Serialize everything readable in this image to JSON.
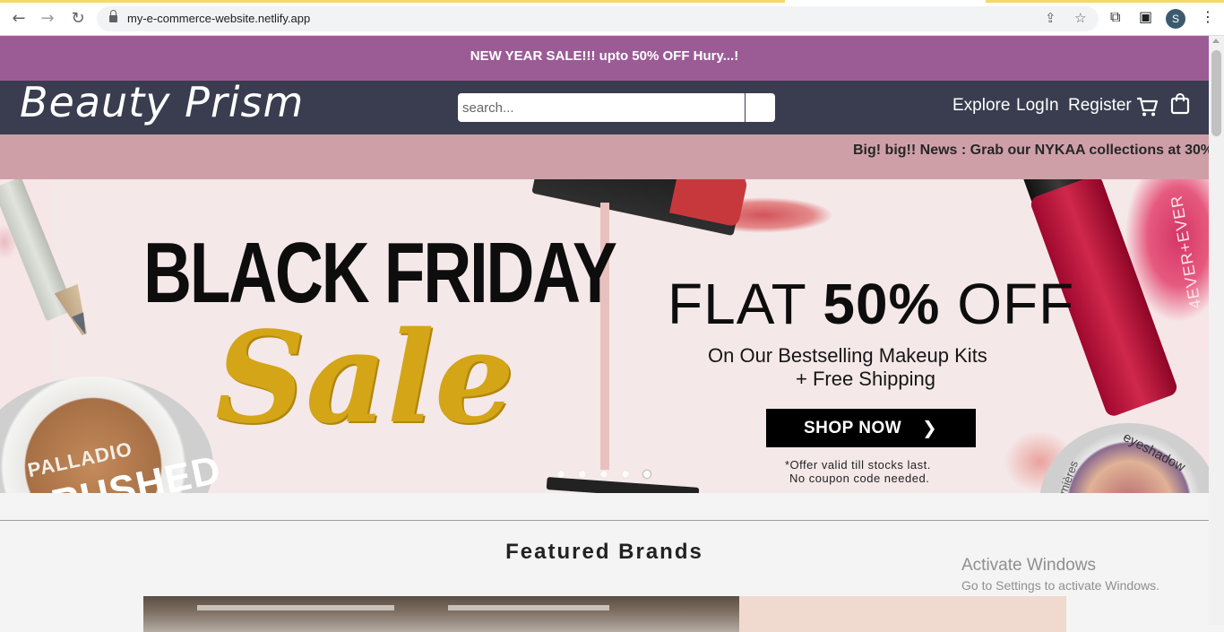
{
  "browser": {
    "url": "my-e-commerce-website.netlify.app",
    "profile_initial": "S",
    "icons": [
      "back-icon",
      "forward-icon",
      "reload-icon",
      "lock-icon",
      "share-icon",
      "star-icon",
      "extensions-icon",
      "sidebar-icon",
      "more-icon"
    ]
  },
  "sale_bar": {
    "text": "NEW YEAR SALE!!! upto 50% OFF Hury...!"
  },
  "header": {
    "logo": "Beauty Prism",
    "search_placeholder": "search...",
    "nav": {
      "explore": "Explore",
      "login": "LogIn",
      "register": "Register"
    },
    "icons": [
      "cart-icon",
      "shopping-bag-icon"
    ]
  },
  "news_bar": {
    "text": "Big! big!! News : Grab our NYKAA collections at 30%"
  },
  "banner": {
    "title": "BLACK FRIDAY",
    "script": "Sale",
    "flat_prefix": "FLAT ",
    "flat_percent": "50%",
    "flat_suffix": " OFF",
    "subtitle_1": "On Our Bestselling Makeup Kits",
    "subtitle_2": "+ Free Shipping",
    "cta": "SHOP NOW",
    "offer_1": "*Offer valid till stocks last.",
    "offer_2": "No coupon code needed.",
    "compact_brand": "PALLADIO",
    "compact_name": "CRUSHED",
    "gloss_text": "PALLADIO  4EVER+EVER",
    "eyeshadow_text": "eyeshadow",
    "eyeshadow_text_2": "lumières",
    "slides": 5,
    "active_slide": 5
  },
  "featured": {
    "title": "Featured Brands"
  },
  "watermark": {
    "line1": "Activate Windows",
    "line2": "Go to Settings to activate Windows."
  },
  "colors": {
    "sale_bar": "#9b5c96",
    "header": "#393d4f",
    "news_bar": "#cf9fa8",
    "banner_bg": "#f5e8e9",
    "gold": "#d4a517"
  }
}
